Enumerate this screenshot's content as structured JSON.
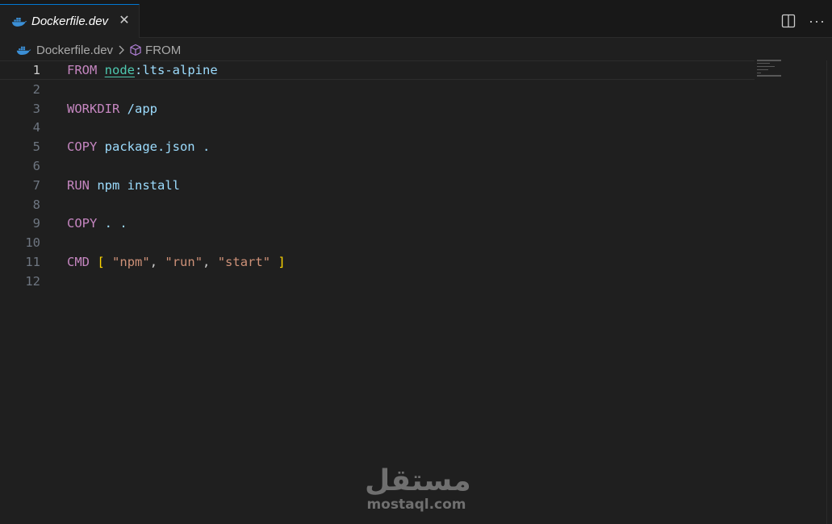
{
  "tab": {
    "title": "Dockerfile.dev",
    "close_glyph": "✕",
    "icon": "docker-whale-icon"
  },
  "actions": {
    "split_icon": "split-editor-icon",
    "more_glyph": "···"
  },
  "breadcrumb": {
    "file": "Dockerfile.dev",
    "symbol": "FROM"
  },
  "editor": {
    "active_line": 1,
    "lines": [
      {
        "num": "1",
        "tokens": [
          {
            "t": "FROM",
            "c": "kw"
          },
          {
            "t": " ",
            "c": "punc"
          },
          {
            "t": "node",
            "c": "img"
          },
          {
            "t": ":lts-alpine",
            "c": "id"
          }
        ]
      },
      {
        "num": "2",
        "tokens": []
      },
      {
        "num": "3",
        "tokens": [
          {
            "t": "WORKDIR",
            "c": "kw"
          },
          {
            "t": " /app",
            "c": "id"
          }
        ]
      },
      {
        "num": "4",
        "tokens": []
      },
      {
        "num": "5",
        "tokens": [
          {
            "t": "COPY",
            "c": "kw"
          },
          {
            "t": " package.json .",
            "c": "id"
          }
        ]
      },
      {
        "num": "6",
        "tokens": []
      },
      {
        "num": "7",
        "tokens": [
          {
            "t": "RUN",
            "c": "kw"
          },
          {
            "t": " npm install",
            "c": "id"
          }
        ]
      },
      {
        "num": "8",
        "tokens": []
      },
      {
        "num": "9",
        "tokens": [
          {
            "t": "COPY",
            "c": "kw"
          },
          {
            "t": " . .",
            "c": "id"
          }
        ]
      },
      {
        "num": "10",
        "tokens": []
      },
      {
        "num": "11",
        "tokens": [
          {
            "t": "CMD",
            "c": "kw"
          },
          {
            "t": " ",
            "c": "punc"
          },
          {
            "t": "[",
            "c": "br"
          },
          {
            "t": " ",
            "c": "punc"
          },
          {
            "t": "\"npm\"",
            "c": "str"
          },
          {
            "t": ", ",
            "c": "punc"
          },
          {
            "t": "\"run\"",
            "c": "str"
          },
          {
            "t": ", ",
            "c": "punc"
          },
          {
            "t": "\"start\"",
            "c": "str"
          },
          {
            "t": " ",
            "c": "punc"
          },
          {
            "t": "]",
            "c": "br"
          }
        ]
      },
      {
        "num": "12",
        "tokens": []
      }
    ]
  },
  "watermark": {
    "arabic": "مستقل",
    "latin": "mostaql.com"
  },
  "colors": {
    "keyword": "#c586c0",
    "identifier": "#9cdcfe",
    "image": "#4ec9b0",
    "string": "#ce9178",
    "bracket": "#ffd700",
    "accent": "#0078d4"
  }
}
